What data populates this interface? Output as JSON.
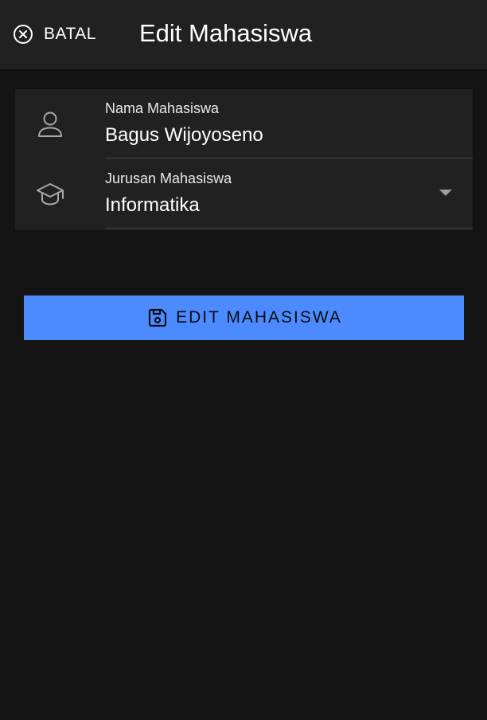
{
  "header": {
    "cancel_label": "BATAL",
    "cancel_icon": "close-circle-icon",
    "title": "Edit Mahasiswa",
    "background": "#212121"
  },
  "form": {
    "name_field": {
      "icon": "person-icon",
      "label": "Nama Mahasiswa",
      "value": "Bagus Wijoyoseno"
    },
    "major_field": {
      "icon": "graduation-cap-icon",
      "label": "Jurusan Mahasiswa",
      "value": "Informatika"
    }
  },
  "submit": {
    "icon": "save-icon",
    "label": "EDIT MAHASISWA",
    "color": "#4b8bff"
  },
  "theme": {
    "page_background": "#141414",
    "card_background": "#212121"
  }
}
